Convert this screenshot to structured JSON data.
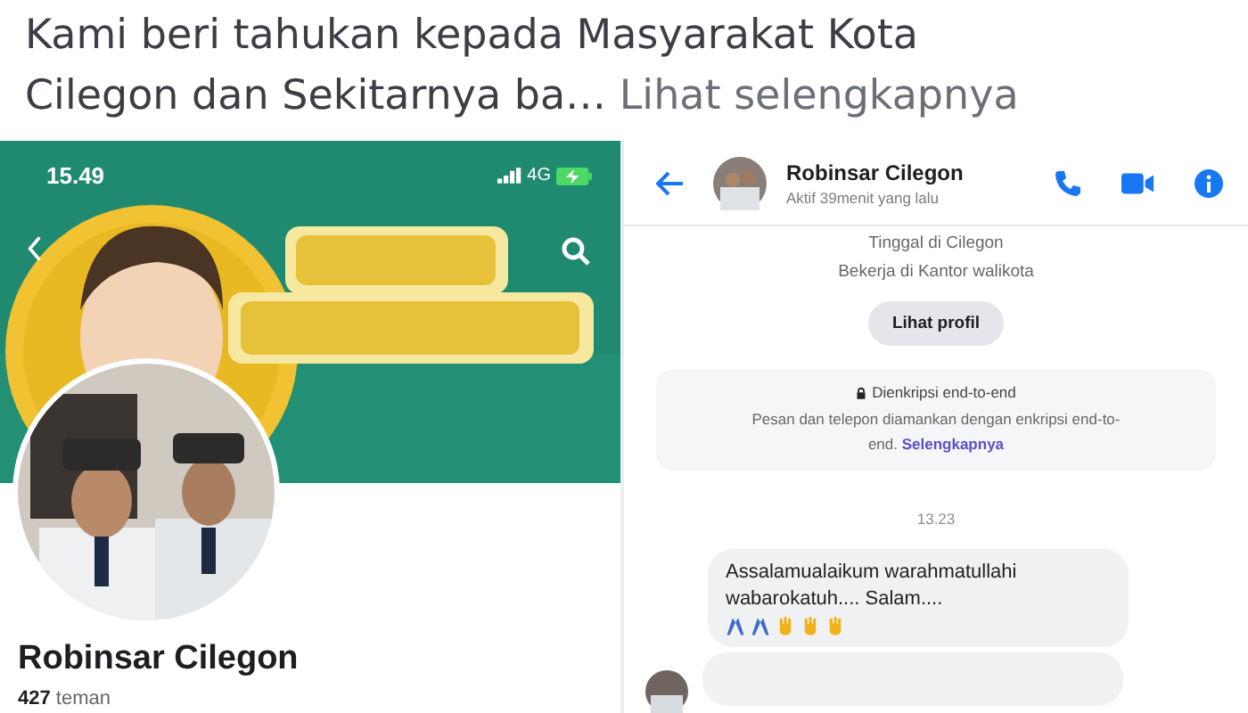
{
  "post": {
    "text": "Kami beri tahukan kepada Masyarakat Kota Cilegon dan Sekitarnya ba…",
    "link": "Lihat selengkapnya"
  },
  "profile_screen": {
    "status_bar": {
      "time": "15.49",
      "network": "4G"
    },
    "name": "Robinsar Cilegon",
    "friends_count": "427",
    "friends_label": "teman"
  },
  "chat_screen": {
    "contact": {
      "name": "Robinsar Cilegon",
      "status": "Aktif 39menit yang lalu"
    },
    "intro": [
      "Tinggal di Cilegon",
      "Bekerja di Kantor walikota"
    ],
    "profile_button": "Lihat profil",
    "encryption": {
      "title": "Dienkripsi end-to-end",
      "text": "Pesan dan telepon diamankan dengan enkripsi end-to-end.",
      "link": "Selengkapnya"
    },
    "timestamp": "13.23",
    "messages": [
      {
        "text": "Assalamualaikum warahmatullahi wabarokatuh.... Salam...."
      }
    ]
  }
}
